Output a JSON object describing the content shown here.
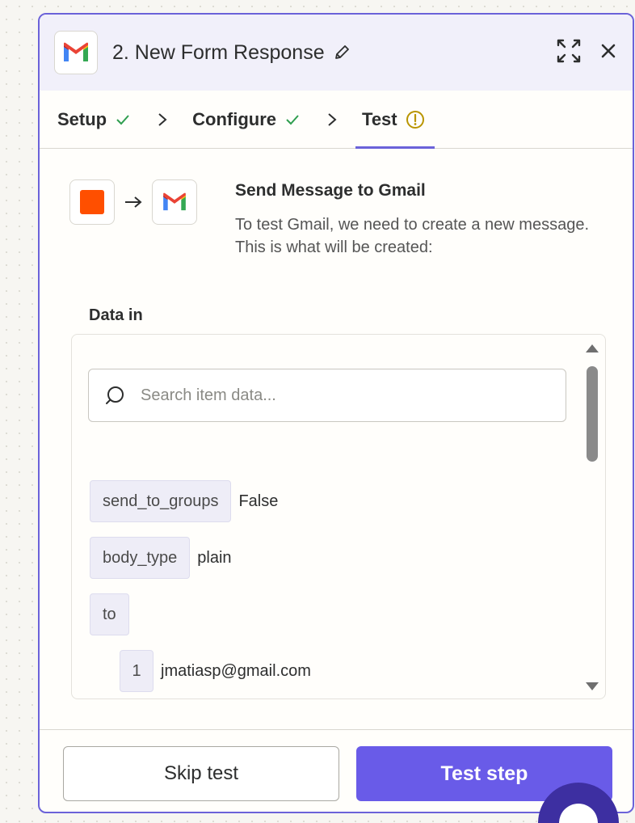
{
  "header": {
    "title": "2. New Form Response",
    "app_icon": "gmail-icon",
    "edit_icon": "pencil-icon",
    "expand_icon": "expand-icon",
    "close_icon": "close-icon"
  },
  "steps": [
    {
      "label": "Setup",
      "status": "complete"
    },
    {
      "label": "Configure",
      "status": "complete"
    },
    {
      "label": "Test",
      "status": "warning"
    }
  ],
  "colors": {
    "accent": "#6b62d9",
    "primary_button": "#695be8",
    "check": "#2f9e4f",
    "warning": "#b99500",
    "trigger_app": "#ff4f00"
  },
  "summary": {
    "title": "Send Message to Gmail",
    "description": "To test Gmail, we need to create a new message. This is what will be created:"
  },
  "data_tab": {
    "label": "Data in"
  },
  "search": {
    "placeholder": "Search item data..."
  },
  "data_items": [
    {
      "key": "send_to_groups",
      "value": "False"
    },
    {
      "key": "body_type",
      "value": "plain"
    },
    {
      "key": "to",
      "value": ""
    },
    {
      "key": "1",
      "value": "jmatiasp@gmail.com"
    }
  ],
  "footer": {
    "skip_label": "Skip test",
    "test_label": "Test step"
  }
}
